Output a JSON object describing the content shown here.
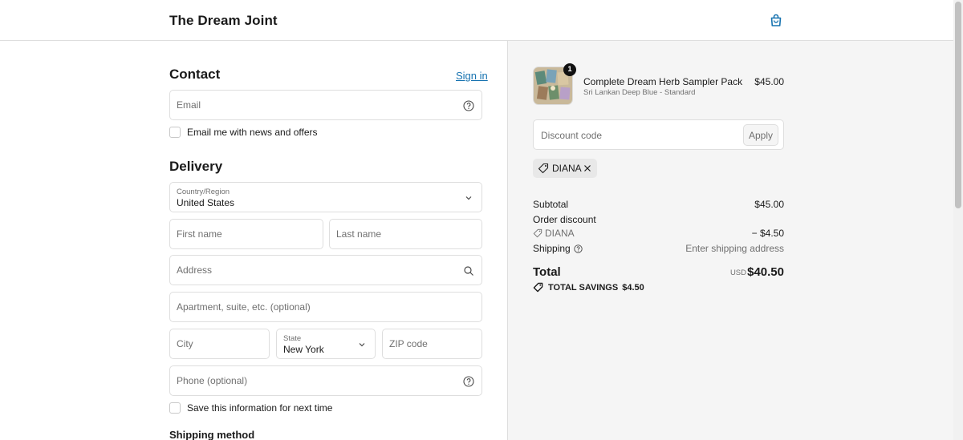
{
  "header": {
    "brand": "The Dream Joint",
    "cart_icon": "shopping-bag-icon",
    "accent": "#1773b0"
  },
  "contact": {
    "title": "Contact",
    "sign_in": "Sign in",
    "email_placeholder": "Email",
    "help_icon": "question-circle-icon",
    "newsletter_label": "Email me with news and offers"
  },
  "delivery": {
    "title": "Delivery",
    "country_label": "Country/Region",
    "country_value": "United States",
    "first_name_placeholder": "First name",
    "last_name_placeholder": "Last name",
    "address_placeholder": "Address",
    "apartment_placeholder": "Apartment, suite, etc. (optional)",
    "city_placeholder": "City",
    "state_label": "State",
    "state_value": "New York",
    "zip_placeholder": "ZIP code",
    "phone_placeholder": "Phone (optional)",
    "save_info_label": "Save this information for next time",
    "shipping_method_title": "Shipping method"
  },
  "summary": {
    "product": {
      "quantity": "1",
      "name": "Complete Dream Herb Sampler Pack",
      "variant": "Sri Lankan Deep Blue - Standard",
      "price": "$45.00"
    },
    "discount_placeholder": "Discount code",
    "apply_label": "Apply",
    "applied_code": "DIANA",
    "subtotal_label": "Subtotal",
    "subtotal_value": "$45.00",
    "order_discount_label": "Order discount",
    "discount_code": "DIANA",
    "discount_value": "− $4.50",
    "shipping_label": "Shipping",
    "shipping_value": "Enter shipping address",
    "total_label": "Total",
    "currency": "USD",
    "total_value": "$40.50",
    "savings_label": "TOTAL SAVINGS",
    "savings_value": "$4.50"
  }
}
